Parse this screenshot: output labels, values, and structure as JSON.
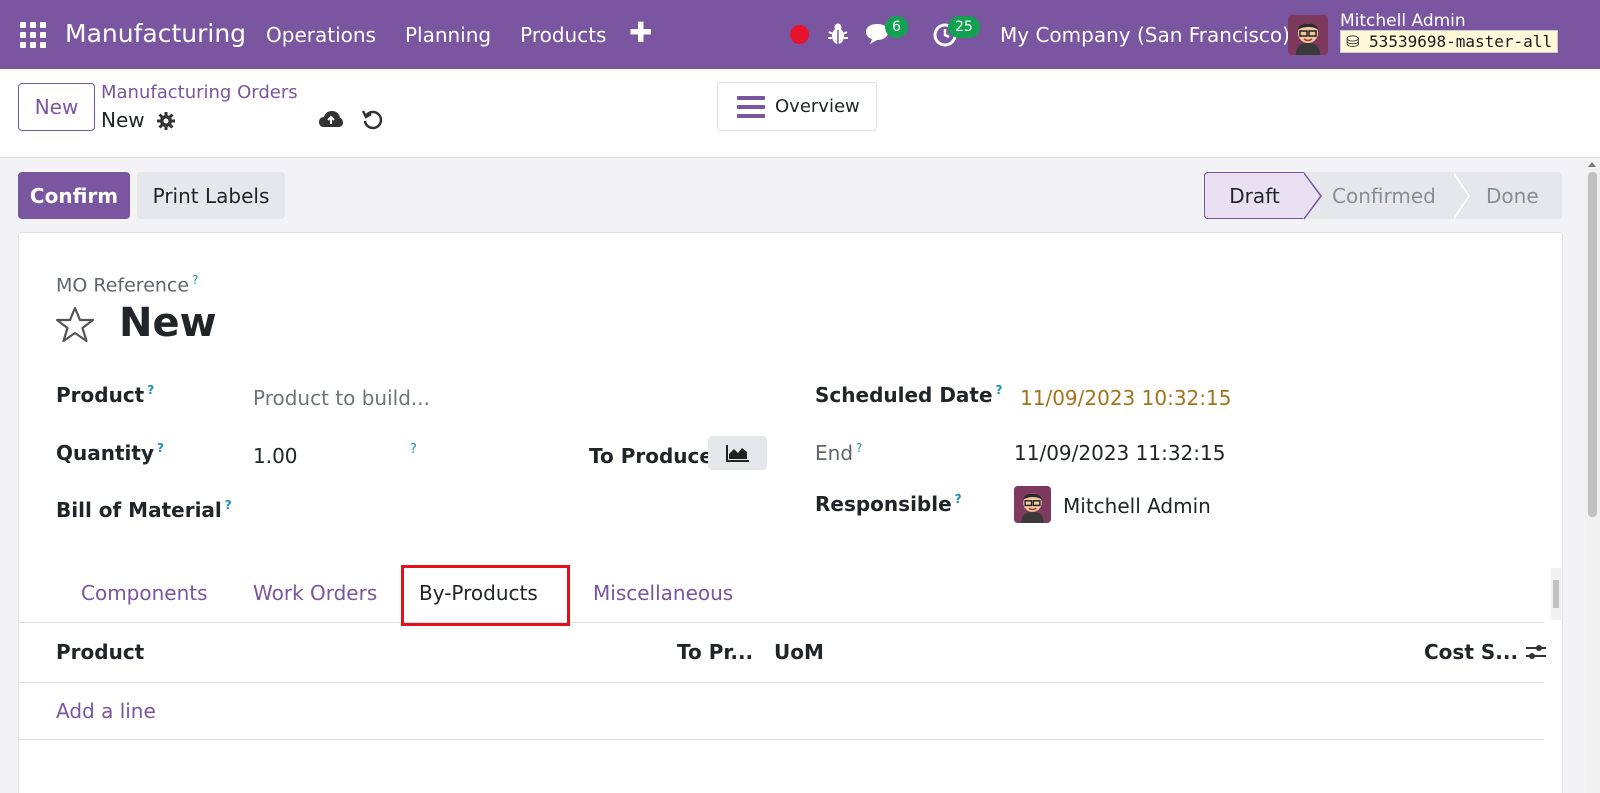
{
  "navbar": {
    "app_name": "Manufacturing",
    "menu": [
      "Operations",
      "Planning",
      "Products"
    ],
    "messages_count": "6",
    "activities_count": "25",
    "company": "My Company (San Francisco)",
    "user_name": "Mitchell Admin",
    "database": "53539698-master-all"
  },
  "control": {
    "new_label": "New",
    "breadcrumb": "Manufacturing Orders",
    "record_name": "New",
    "overview_label": "Overview"
  },
  "actions": {
    "confirm_label": "Confirm",
    "print_label": "Print Labels"
  },
  "statusbar": {
    "draft": "Draft",
    "confirmed": "Confirmed",
    "done": "Done"
  },
  "form": {
    "mo_ref_label": "MO Reference",
    "title": "New",
    "product_label": "Product",
    "product_placeholder": "Product to build...",
    "quantity_label": "Quantity",
    "quantity_value": "1.00",
    "to_produce_label": "To Produce",
    "bom_label": "Bill of Material",
    "scheduled_label": "Scheduled Date",
    "scheduled_value": "11/09/2023 10:32:15",
    "end_label": "End",
    "end_value": "11/09/2023 11:32:15",
    "responsible_label": "Responsible",
    "responsible_value": "Mitchell Admin",
    "help_mark": "?"
  },
  "tabs": {
    "components": "Components",
    "work_orders": "Work Orders",
    "by_products": "By-Products",
    "misc": "Miscellaneous"
  },
  "table": {
    "columns": [
      "Product",
      "To Pr...",
      "UoM",
      "Cost S..."
    ],
    "add_line": "Add a line"
  },
  "colors": {
    "brand": "#7a55a0",
    "highlight": "#e5111a"
  }
}
